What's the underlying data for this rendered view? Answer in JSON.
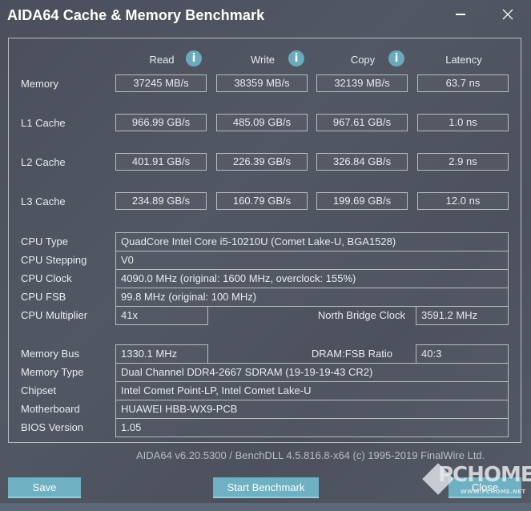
{
  "window": {
    "title": "AIDA64 Cache & Memory Benchmark",
    "minimize_icon": "minimize-icon",
    "close_icon": "close-icon"
  },
  "benchmark": {
    "columns": [
      {
        "label": "Read",
        "has_info": true
      },
      {
        "label": "Write",
        "has_info": true
      },
      {
        "label": "Copy",
        "has_info": true
      },
      {
        "label": "Latency",
        "has_info": false
      }
    ],
    "rows": [
      {
        "label": "Memory",
        "values": [
          "37245 MB/s",
          "38359 MB/s",
          "32139 MB/s",
          "63.7 ns"
        ]
      },
      {
        "label": "L1 Cache",
        "values": [
          "966.99 GB/s",
          "485.09 GB/s",
          "967.61 GB/s",
          "1.0 ns"
        ]
      },
      {
        "label": "L2 Cache",
        "values": [
          "401.91 GB/s",
          "226.39 GB/s",
          "326.84 GB/s",
          "2.9 ns"
        ]
      },
      {
        "label": "L3 Cache",
        "values": [
          "234.89 GB/s",
          "160.79 GB/s",
          "199.69 GB/s",
          "12.0 ns"
        ]
      }
    ],
    "info_icon_glyph": "i"
  },
  "cpu_info": {
    "cpu_type": {
      "label": "CPU Type",
      "value": "QuadCore Intel Core i5-10210U  (Comet Lake-U, BGA1528)"
    },
    "cpu_stepping": {
      "label": "CPU Stepping",
      "value": "V0"
    },
    "cpu_clock": {
      "label": "CPU Clock",
      "value": "4090.0 MHz  (original: 1600 MHz, overclock: 155%)"
    },
    "cpu_fsb": {
      "label": "CPU FSB",
      "value": "99.8 MHz  (original: 100 MHz)"
    },
    "cpu_multiplier": {
      "label": "CPU Multiplier",
      "value": "41x"
    },
    "north_bridge_clock": {
      "label": "North Bridge Clock",
      "value": "3591.2 MHz"
    }
  },
  "memory_info": {
    "memory_bus": {
      "label": "Memory Bus",
      "value": "1330.1 MHz"
    },
    "dram_fsb_ratio": {
      "label": "DRAM:FSB Ratio",
      "value": "40:3"
    },
    "memory_type": {
      "label": "Memory Type",
      "value": "Dual Channel DDR4-2667 SDRAM  (19-19-19-43 CR2)"
    },
    "chipset": {
      "label": "Chipset",
      "value": "Intel Comet Point-LP, Intel Comet Lake-U"
    },
    "motherboard": {
      "label": "Motherboard",
      "value": "HUAWEI HBB-WX9-PCB"
    },
    "bios_version": {
      "label": "BIOS Version",
      "value": "1.05"
    }
  },
  "footer": {
    "version_text": "AIDA64 v6.20.5300 / BenchDLL 4.5.816.8-x64  (c) 1995-2019 FinalWire Ltd."
  },
  "buttons": {
    "save": "Save",
    "start_benchmark": "Start Benchmark",
    "close": "Close"
  },
  "watermark": {
    "text": "PCHOME",
    "subtext": "WWW.PCHOME.NET"
  },
  "colors": {
    "accent_button": "#6fb0c2",
    "info_icon": "#6ba9bd",
    "background": "#4e535f",
    "border": "#b8bcc4"
  }
}
